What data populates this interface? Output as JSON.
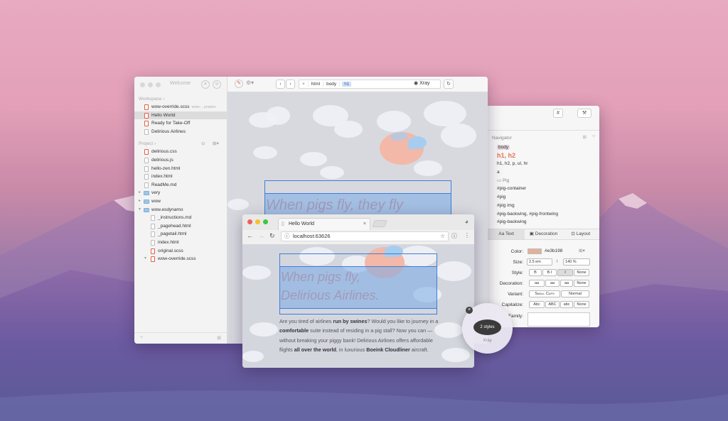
{
  "editor": {
    "window_title": "Welcome",
    "workspace_header": "Workspace",
    "workspace_items": [
      {
        "label": "wow-override.scss",
        "hint": "wow-...ynamo"
      },
      {
        "label": "Hello World"
      },
      {
        "label": "Ready for Take-Off"
      },
      {
        "label": "Delirious Airlines"
      }
    ],
    "project_header": "Project",
    "project_items": [
      {
        "label": "delirious.css"
      },
      {
        "label": "delirious.js"
      },
      {
        "label": "hello-zen.html"
      },
      {
        "label": "index.html"
      },
      {
        "label": "ReadMe.md"
      },
      {
        "label": "very"
      },
      {
        "label": "wow"
      },
      {
        "label": "wow.esdynamo"
      },
      {
        "label": "_instructions.md"
      },
      {
        "label": "_pagehead.html"
      },
      {
        "label": "_pagetail.html"
      },
      {
        "label": "index.html"
      },
      {
        "label": "original.scss"
      },
      {
        "label": "wow-override.scss"
      }
    ],
    "breadcrumbs": [
      "html",
      "body",
      "h1"
    ],
    "xray_label": "Xray",
    "headline": "When pigs fly, they fly"
  },
  "inspector": {
    "hash_label": "#",
    "navigator_title": "Navigator",
    "nav_items": [
      "body",
      "h1, h2",
      "h1, h2, p, ul, hr",
      "a",
      "Pig",
      "#pig-container",
      "#pig",
      "#pig img",
      "#pig-backwing, #pig-frontwing",
      "#pig-backwing"
    ],
    "tabs": [
      "Text",
      "Decoration",
      "Layout"
    ],
    "color_label": "Color:",
    "color_value": "#e3b198",
    "color_swatch": "#e3b198",
    "size_label": "Size:",
    "size_value": "2.5 em",
    "line_height_value": "140 %",
    "style_label": "Style:",
    "style_opts": [
      "B",
      "B·I",
      "I",
      "None"
    ],
    "decoration_label": "Decoration:",
    "decoration_opts": [
      "aa",
      "aa",
      "aa",
      "None"
    ],
    "variant_label": "Variant:",
    "variant_opts": [
      "Small Caps",
      "Normal"
    ],
    "capitalize_label": "Capitalize:",
    "capitalize_opts": [
      "Abc",
      "ABC",
      "abc",
      "None"
    ],
    "family_label": "Family:"
  },
  "browser": {
    "tab_title": "Hello World",
    "url": "localhost:63626",
    "headline_1": "When pigs fly,",
    "headline_2": "Delirious Airlines.",
    "para_1": "Are you tired of airlines",
    "para_b1": "run by swines",
    "para_2": "? Would you like to journey in a",
    "para_b2": "comfortable",
    "para_3": "suite instead of residing in a pig stall? Now you can — without breaking your piggy bank! Delirious Airlines offers affordable flights",
    "para_b3": "all over the world",
    "para_4": ", in luxurious",
    "para_b4": "Boeink Cloudliner",
    "para_5": "aircraft."
  },
  "xray_hud": {
    "badge": "2 styles",
    "caption": "Xray"
  }
}
